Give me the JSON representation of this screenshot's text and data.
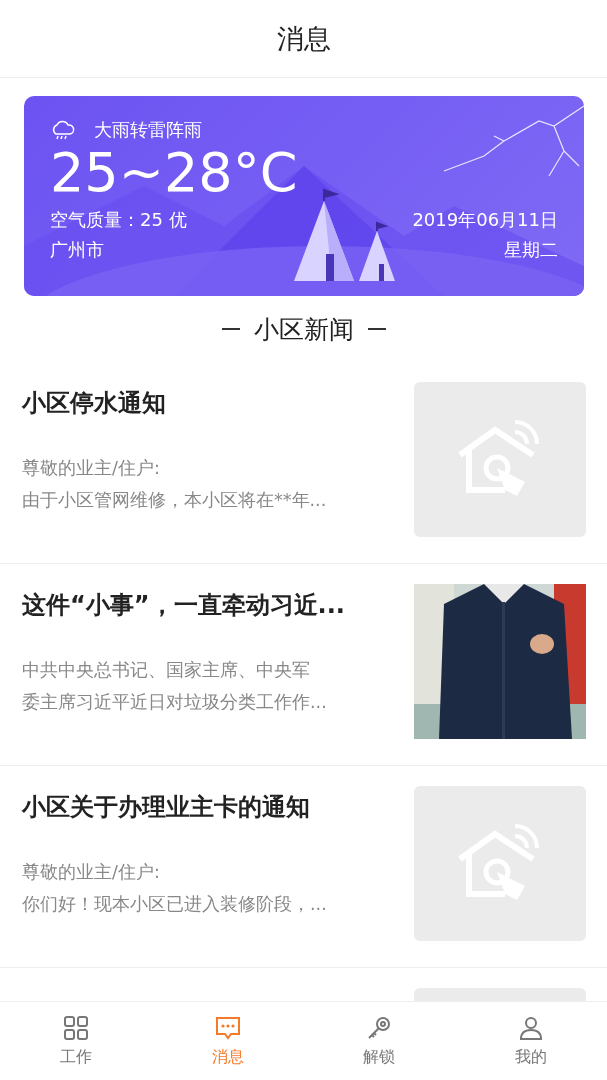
{
  "header": {
    "title": "消息"
  },
  "weather": {
    "condition": "大雨转雷阵雨",
    "temperature": "25~28°C",
    "air_quality": "空气质量：25 优",
    "date": "2019年06月11日",
    "city": "广州市",
    "weekday": "星期二"
  },
  "section_title": "小区新闻",
  "news": [
    {
      "title": "小区停水通知",
      "lines": [
        "尊敬的业主/住户:",
        "由于小区管网维修，本小区将在**年..."
      ],
      "thumbnail": {
        "kind": "placeholder"
      }
    },
    {
      "title": "这件“小事”，一直牵动习近...",
      "lines": [
        "中共中央总书记、国家主席、中央军",
        "委主席习近平近日对垃圾分类工作作..."
      ]
    },
    {
      "title": "小区关于办理业主卡的通知",
      "lines": [
        "尊敬的业主/住户:",
        "你们好！现本小区已进入装修阶段，..."
      ],
      "thumbnail": {
        "kind": "placeholder"
      }
    },
    {
      "thumbnail": {
        "kind": "placeholder"
      }
    }
  ],
  "tabs": [
    {
      "label": "工作",
      "selected": false
    },
    {
      "label": "消息",
      "selected": true
    },
    {
      "label": "解锁",
      "selected": false
    },
    {
      "label": "我的",
      "selected": false
    }
  ]
}
